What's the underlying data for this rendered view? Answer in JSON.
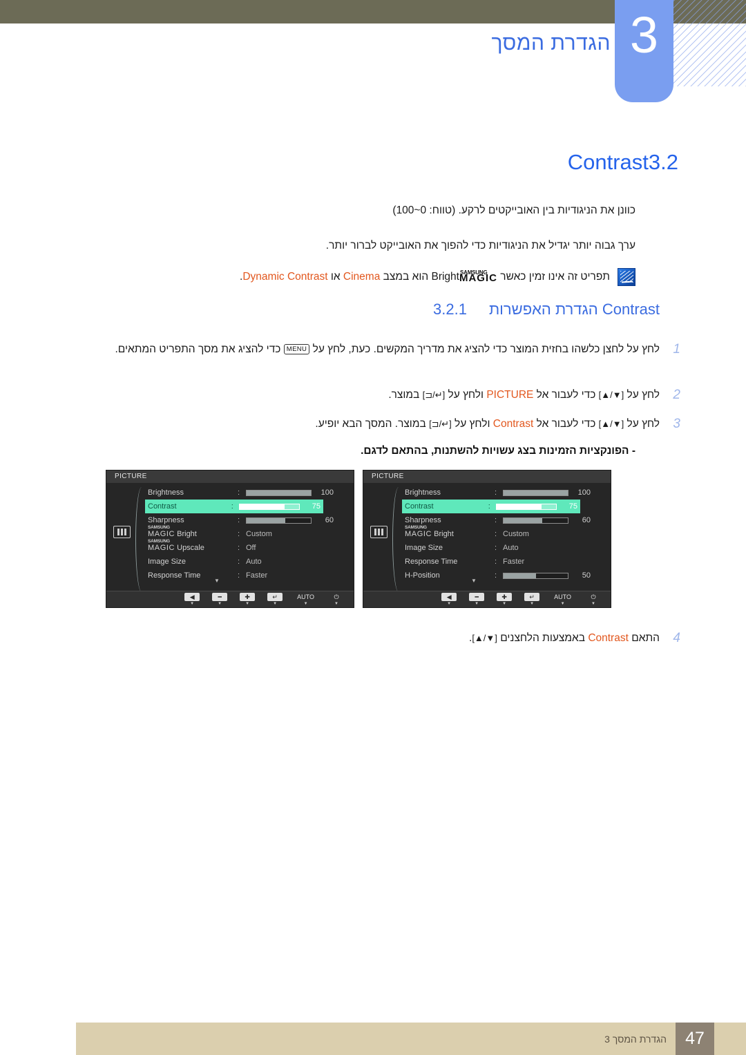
{
  "header": {
    "chapter_number": "3",
    "chapter_title": "הגדרת המסך"
  },
  "section": {
    "number": "3.2",
    "title": "Contrast",
    "paragraph_1": "כוונן את הניגודיות בין האובייקטים לרקע. (טווח: 0~100)",
    "paragraph_2": "ערך גבוה יותר יגדיל את הניגודיות כדי להפוך את האובייקט לברור יותר.",
    "note": {
      "icon": "note-pen-icon",
      "text_a": "תפריט זה אינו זמין כאשר ",
      "magic_samsung": "SAMSUNG",
      "magic_word": "MAGIC",
      "magic_bright": "Bright",
      "text_b": " הוא במצב ",
      "link_cinema": "Cinema",
      "text_c": " או ",
      "link_dynamic": "Dynamic Contrast",
      "text_d": "."
    }
  },
  "subsection": {
    "number": "3.2.1",
    "title_he": "הגדרת האפשרות",
    "title_en": "Contrast"
  },
  "steps": [
    {
      "num": "1",
      "parts": [
        {
          "t": "text",
          "v": "לחץ על לחצן כלשהו בחזית המוצר כדי להציג את מדריך המקשים. כעת, לחץ על "
        },
        {
          "t": "keycap",
          "v": "MENU"
        },
        {
          "t": "text",
          "v": " כדי להציג את מסך התפריט המתאים."
        }
      ]
    },
    {
      "num": "2",
      "parts": [
        {
          "t": "text",
          "v": "לחץ על "
        },
        {
          "t": "glyph",
          "v": "[▲/▼]"
        },
        {
          "t": "text",
          "v": " כדי לעבור אל "
        },
        {
          "t": "orange",
          "v": "PICTURE"
        },
        {
          "t": "text",
          "v": " ולחץ על "
        },
        {
          "t": "glyph",
          "v": "[⊐/↵]"
        },
        {
          "t": "text",
          "v": " במוצר."
        }
      ]
    },
    {
      "num": "3",
      "parts": [
        {
          "t": "text",
          "v": "לחץ על "
        },
        {
          "t": "glyph",
          "v": "[▲/▼]"
        },
        {
          "t": "text",
          "v": " כדי לעבור אל "
        },
        {
          "t": "orange",
          "v": "Contrast"
        },
        {
          "t": "text",
          "v": " ולחץ על "
        },
        {
          "t": "glyph",
          "v": "[⊐/↵]"
        },
        {
          "t": "text",
          "v": " במוצר. המסך הבא יופיע."
        }
      ]
    },
    {
      "num": "4",
      "parts": [
        {
          "t": "text",
          "v": "התאם "
        },
        {
          "t": "orange",
          "v": "Contrast"
        },
        {
          "t": "text",
          "v": " באמצעות הלחצנים "
        },
        {
          "t": "glyph",
          "v": "[▲/▼]"
        },
        {
          "t": "text",
          "v": "."
        }
      ]
    }
  ],
  "model_note": "- הפונקציות הזמינות בצג עשויות להשתנות, בהתאם לדגם.",
  "osd_panels": [
    {
      "title": "PICTURE",
      "side_icon": "picture-icon",
      "rows": [
        {
          "label": "Brightness",
          "type": "slider",
          "fill": 100,
          "value": "100",
          "selected": false
        },
        {
          "label": "Contrast",
          "type": "slider",
          "fill": 75,
          "value": "75",
          "selected": true
        },
        {
          "label": "Sharpness",
          "type": "slider",
          "fill": 60,
          "value": "60",
          "selected": false
        },
        {
          "label": "MAGICBright",
          "type": "magic",
          "magic_top": "SAMSUNG",
          "magic_main": "MAGIC",
          "magic_suffix": "Bright",
          "value": "Custom",
          "selected": false
        },
        {
          "label": "MAGICUpscale",
          "type": "magic",
          "magic_top": "SAMSUNG",
          "magic_main": "MAGIC",
          "magic_suffix": "Upscale",
          "value": "Off",
          "selected": false
        },
        {
          "label": "Image Size",
          "type": "text",
          "value": "Auto",
          "selected": false
        },
        {
          "label": "Response Time",
          "type": "text",
          "value": "Faster",
          "selected": false
        }
      ],
      "footer_buttons": [
        "◀",
        "━",
        "✚",
        "↵",
        "AUTO",
        "⏻"
      ]
    },
    {
      "title": "PICTURE",
      "side_icon": "picture-icon",
      "rows": [
        {
          "label": "Brightness",
          "type": "slider",
          "fill": 100,
          "value": "100",
          "selected": false
        },
        {
          "label": "Contrast",
          "type": "slider",
          "fill": 75,
          "value": "75",
          "selected": true
        },
        {
          "label": "Sharpness",
          "type": "slider",
          "fill": 60,
          "value": "60",
          "selected": false
        },
        {
          "label": "MAGICBright",
          "type": "magic",
          "magic_top": "SAMSUNG",
          "magic_main": "MAGIC",
          "magic_suffix": "Bright",
          "value": "Custom",
          "selected": false
        },
        {
          "label": "Image Size",
          "type": "text",
          "value": "Auto",
          "selected": false
        },
        {
          "label": "Response Time",
          "type": "text",
          "value": "Faster",
          "selected": false
        },
        {
          "label": "H-Position",
          "type": "slider",
          "fill": 50,
          "value": "50",
          "selected": false
        }
      ],
      "footer_buttons": [
        "◀",
        "━",
        "✚",
        "↵",
        "AUTO",
        "⏻"
      ]
    }
  ],
  "footer": {
    "page_number": "47",
    "text": "הגדרת המסך 3"
  },
  "colors": {
    "header_bar": "#6c6b56",
    "tab_blue": "#7a9ef0",
    "heading_blue": "#2563eb",
    "orange": "#e2571e",
    "osd_green": "#5fe8bb",
    "footer_tan": "#dbcfae",
    "footer_num_box": "#8d8273"
  }
}
